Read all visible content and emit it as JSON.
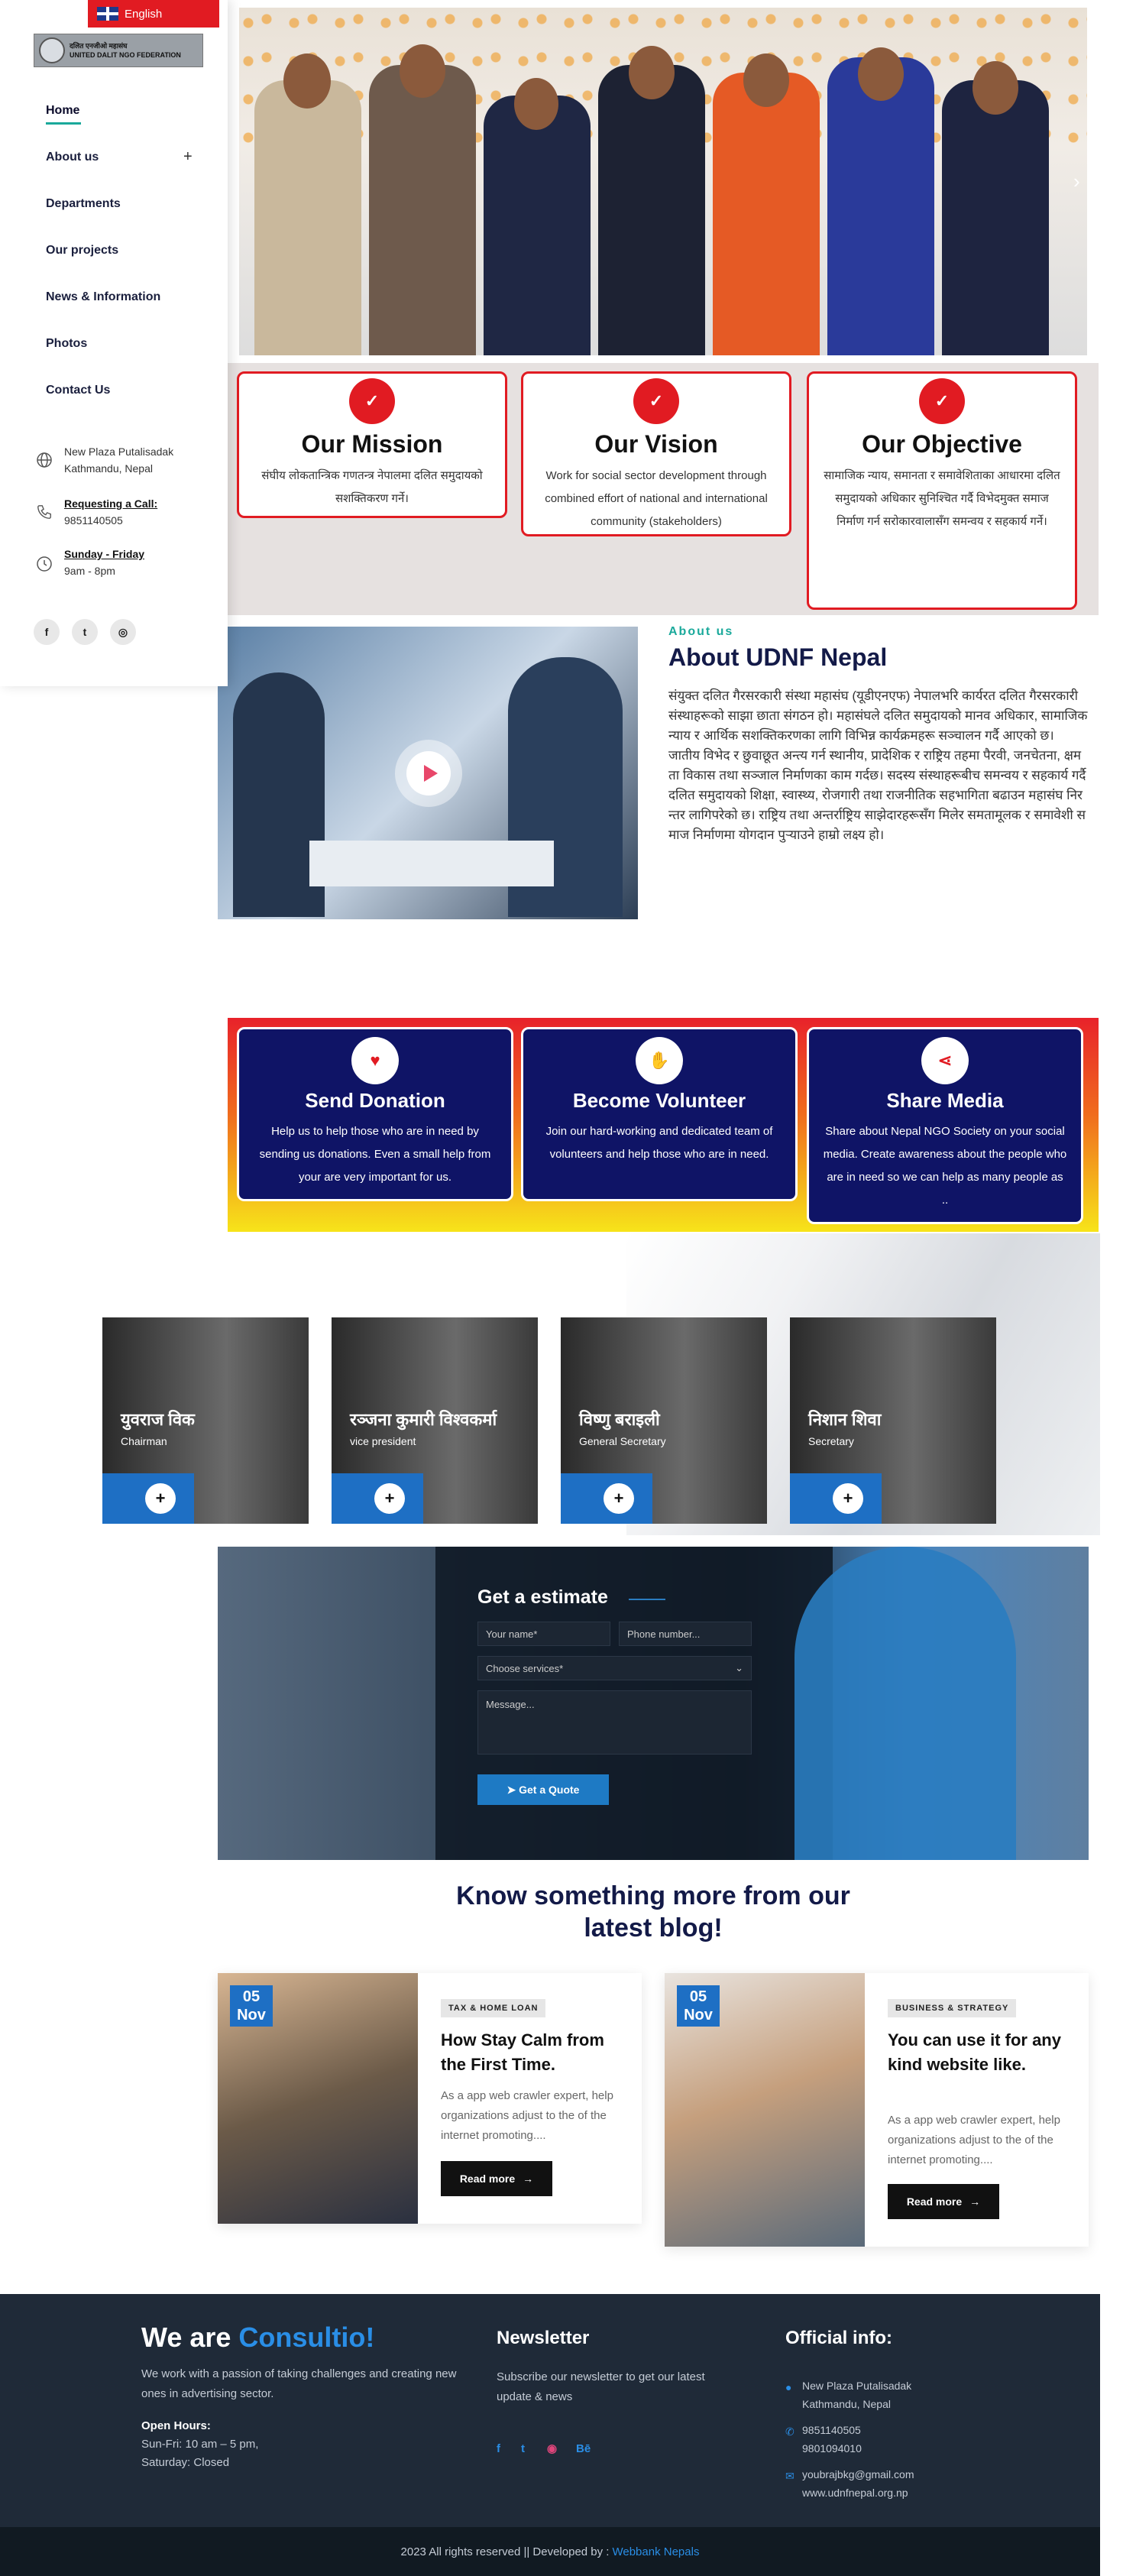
{
  "lang": {
    "label": "English"
  },
  "logo": {
    "line1": "दलित एनजीओ महासंघ",
    "line2": "UNITED DALIT NGO FEDERATION"
  },
  "nav": {
    "items": [
      "Home",
      "About us",
      "Departments",
      "Our projects",
      "News & Information",
      "Photos",
      "Contact Us"
    ],
    "plus": "+"
  },
  "contact": {
    "address1": "New Plaza Putalisadak",
    "address2": "Kathmandu, Nepal",
    "call_title": "Requesting a Call:",
    "call_num": "9851140505",
    "days_title": "Sunday - Friday",
    "hours": "9am - 8pm"
  },
  "social": [
    "f",
    "t",
    "◎"
  ],
  "cards": [
    {
      "title": "Our Mission",
      "text": "संघीय लोकतान्त्रिक गणतन्त्र नेपालमा दलित समुदायको सशक्तिकरण गर्ने।"
    },
    {
      "title": "Our Vision",
      "text": "Work for social sector development through combined effort of national and international community (stakeholders)"
    },
    {
      "title": "Our Objective",
      "text": "सामाजिक न्याय, समानता र समावेशिताका आधारमा दलित समुदायको अधिकार सुनिश्चित गर्दै विभेदमुक्त समाज निर्माण गर्न सरोकारवालासँग समन्वय र सहकार्य गर्ने।"
    }
  ],
  "about": {
    "label": "About us",
    "title": "About UDNF Nepal",
    "text": "संयुक्त दलित गैरसरकारी संस्था महासंघ (यूडीएनएफ) नेपालभरि कार्यरत दलित गैरसरकारी संस्थाहरूको साझा छाता संगठन हो। महासंघले दलित समुदायको मानव अधिकार, सामाजिक न्याय र आर्थिक सशक्तिकरणका लागि विभिन्न कार्यक्रमहरू सञ्चालन गर्दै आएको छ। जातीय विभेद र छुवाछूत अन्त्य गर्न स्थानीय, प्रादेशिक र राष्ट्रिय तहमा पैरवी, जनचेतना, क्षमता विकास तथा सञ्जाल निर्माणका काम गर्दछ। सदस्य संस्थाहरूबीच समन्वय र सहकार्य गर्दै दलित समुदायको शिक्षा, स्वास्थ्य, रोजगारी तथा राजनीतिक सहभागिता बढाउन महासंघ निरन्तर लागिपरेको छ। राष्ट्रिय तथा अन्तर्राष्ट्रिय साझेदारहरूसँग मिलेर समतामूलक र समावेशी समाज निर्माणमा योगदान पुर्‍याउने हाम्रो लक्ष्य हो।"
  },
  "actions": [
    {
      "icon": "♥",
      "title": "Send Donation",
      "text": "Help us to help those who are in need by sending us donations. Even a small help from your are very important for us."
    },
    {
      "icon": "✋",
      "title": "Become Volunteer",
      "text": "Join our hard-working and dedicated team of volunteers and help those who are in need."
    },
    {
      "icon": "⋖",
      "title": "Share Media",
      "text": "Share about Nepal NGO Society on your social media. Create awareness about the people who are in need so we can help as many people as .."
    }
  ],
  "team": [
    {
      "name": "युवराज विक",
      "role": "Chairman"
    },
    {
      "name": "रञ्जना कुमारी विश्वकर्मा",
      "role": "vice president"
    },
    {
      "name": "विष्णु बराइली",
      "role": "General Secretary"
    },
    {
      "name": "निशान शिवा",
      "role": "Secretary"
    }
  ],
  "estimate": {
    "title": "Get a estimate",
    "name_ph": "Your name*",
    "phone_ph": "Phone number...",
    "service_ph": "Choose services*",
    "message_ph": "Message...",
    "button": "Get a Quote"
  },
  "blog": {
    "title": "Know something more from our latest blog!",
    "posts": [
      {
        "day": "05",
        "month": "Nov",
        "tag": "TAX & HOME LOAN",
        "title": "How Stay Calm from the First Time.",
        "excerpt": "As a app web crawler expert, help organizations adjust to the of the internet promoting....",
        "button": "Read more"
      },
      {
        "day": "05",
        "month": "Nov",
        "tag": "BUSINESS & STRATEGY",
        "title": "You can use it for any kind website like.",
        "excerpt": "As a app web crawler expert, help organizations adjust to the of the internet promoting....",
        "button": "Read more"
      }
    ]
  },
  "footer": {
    "we_are": "We are",
    "brand": "Consultio!",
    "desc": "We work with a passion of taking challenges and creating new ones in advertising sector.",
    "open_title": "Open Hours:",
    "open1": "Sun-Fri: 10 am – 5 pm,",
    "open2": "Saturday: Closed",
    "newsletter_title": "Newsletter",
    "newsletter_text": "Subscribe our newsletter to get our latest update & news",
    "social": [
      "f",
      "t",
      "◉",
      "Bē"
    ],
    "official_title": "Official info:",
    "addr1": "New Plaza Putalisadak",
    "addr2": "Kathmandu, Nepal",
    "phone1": "9851140505",
    "phone2": "9801094010",
    "email": "youbrajbkg@gmail.com",
    "web": "www.udnfnepal.org.np",
    "copyright": "2023 All rights reserved || Developed by :",
    "dev": "Webbank Nepals"
  },
  "colors": {
    "red": "#e11b22",
    "navy": "#0f1466",
    "teal": "#1aa99b",
    "blue": "#1e6fc4",
    "footer": "#1f2a38"
  }
}
